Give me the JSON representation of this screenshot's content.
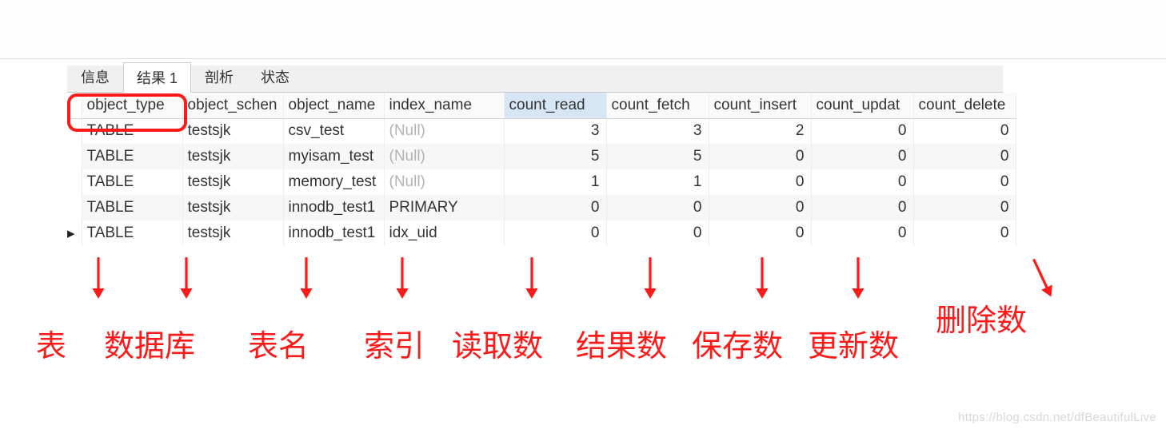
{
  "tabs": {
    "items": [
      {
        "label": "信息",
        "active": false
      },
      {
        "label": "结果 1",
        "active": true
      },
      {
        "label": "剖析",
        "active": false
      },
      {
        "label": "状态",
        "active": false
      }
    ]
  },
  "grid": {
    "columns": [
      "object_type",
      "object_schema",
      "object_name",
      "index_name",
      "count_read",
      "count_fetch",
      "count_insert",
      "count_update",
      "count_delete"
    ],
    "display_headers": [
      "object_type",
      "object_schen",
      "object_name",
      "index_name",
      "count_read",
      "count_fetch",
      "count_insert",
      "count_updat",
      "count_delete"
    ],
    "selected_column_index": 4,
    "current_row_index": 4,
    "null_text": "(Null)",
    "rows": [
      {
        "object_type": "TABLE",
        "object_schema": "testsjk",
        "object_name": "csv_test",
        "index_name": null,
        "count_read": 3,
        "count_fetch": 3,
        "count_insert": 2,
        "count_update": 0,
        "count_delete": 0
      },
      {
        "object_type": "TABLE",
        "object_schema": "testsjk",
        "object_name": "myisam_test",
        "index_name": null,
        "count_read": 5,
        "count_fetch": 5,
        "count_insert": 0,
        "count_update": 0,
        "count_delete": 0
      },
      {
        "object_type": "TABLE",
        "object_schema": "testsjk",
        "object_name": "memory_test",
        "index_name": null,
        "count_read": 1,
        "count_fetch": 1,
        "count_insert": 0,
        "count_update": 0,
        "count_delete": 0
      },
      {
        "object_type": "TABLE",
        "object_schema": "testsjk",
        "object_name": "innodb_test1",
        "index_name": "PRIMARY",
        "count_read": 0,
        "count_fetch": 0,
        "count_insert": 0,
        "count_update": 0,
        "count_delete": 0
      },
      {
        "object_type": "TABLE",
        "object_schema": "testsjk",
        "object_name": "innodb_test1",
        "index_name": "idx_uid",
        "count_read": 0,
        "count_fetch": 0,
        "count_insert": 0,
        "count_update": 0,
        "count_delete": 0
      }
    ]
  },
  "annotations": {
    "labels": [
      "表",
      "数据库",
      "表名",
      "索引",
      "读取数",
      "结果数",
      "保存数",
      "更新数",
      "删除数"
    ]
  },
  "watermark": "https://blog.csdn.net/dfBeautifulLive",
  "row_indicator_glyph": "▸"
}
